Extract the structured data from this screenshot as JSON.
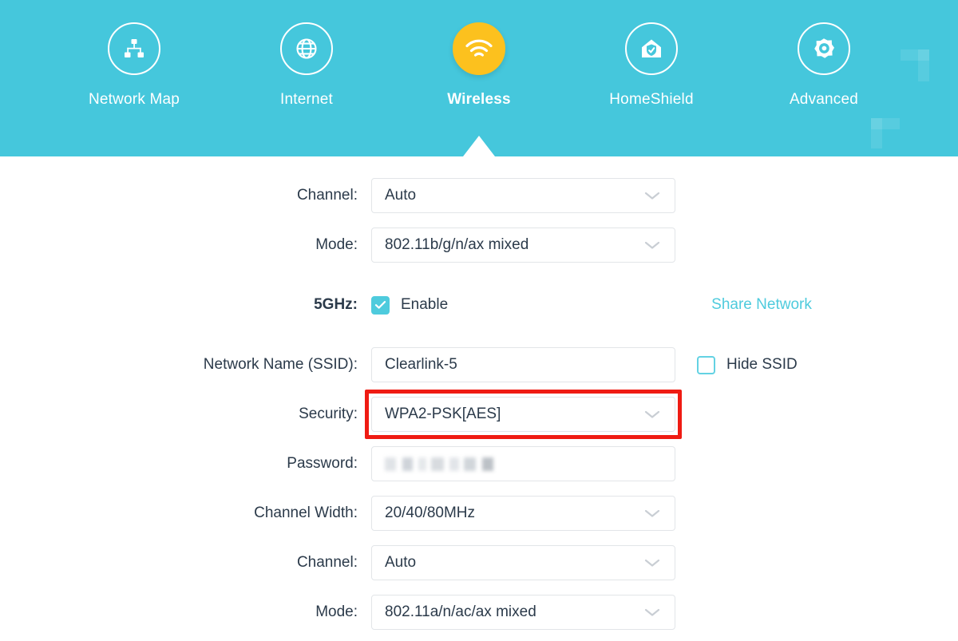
{
  "theme": {
    "header_bg": "#45c7dc",
    "accent_teal": "#4ecbdd",
    "active_icon_bg": "#fcc11e",
    "highlight_red": "#ef1b13",
    "text": "#2b3a4a"
  },
  "nav": {
    "items": [
      {
        "label": "Network Map",
        "icon": "network-map-icon",
        "active": false
      },
      {
        "label": "Internet",
        "icon": "globe-icon",
        "active": false
      },
      {
        "label": "Wireless",
        "icon": "wifi-icon",
        "active": true
      },
      {
        "label": "HomeShield",
        "icon": "home-shield-icon",
        "active": false
      },
      {
        "label": "Advanced",
        "icon": "gear-icon",
        "active": false
      }
    ]
  },
  "form": {
    "rows": [
      {
        "label": "Channel:",
        "type": "select",
        "value": "Auto",
        "name": "channel-24ghz"
      },
      {
        "label": "Mode:",
        "type": "select",
        "value": "802.11b/g/n/ax mixed",
        "name": "mode-24ghz"
      },
      {
        "label": "5GHz:",
        "type": "checkbox",
        "bold_label": true,
        "checkbox_label": "Enable",
        "checked": true,
        "link": "Share Network",
        "name": "band-5ghz-enable"
      },
      {
        "label": "Network Name (SSID):",
        "type": "input",
        "value": "Clearlink-5",
        "placeholder": "",
        "aux_checkbox_label": "Hide SSID",
        "aux_checked": false,
        "name": "ssid-5ghz"
      },
      {
        "label": "Security:",
        "type": "select",
        "value": "WPA2-PSK[AES]",
        "highlighted": true,
        "name": "security-5ghz"
      },
      {
        "label": "Password:",
        "type": "password",
        "value": "",
        "masked": true,
        "name": "password-5ghz"
      },
      {
        "label": "Channel Width:",
        "type": "select",
        "value": "20/40/80MHz",
        "name": "channel-width-5ghz"
      },
      {
        "label": "Channel:",
        "type": "select",
        "value": "Auto",
        "name": "channel-5ghz"
      },
      {
        "label": "Mode:",
        "type": "select",
        "value": "802.11a/n/ac/ax mixed",
        "name": "mode-5ghz"
      }
    ]
  }
}
